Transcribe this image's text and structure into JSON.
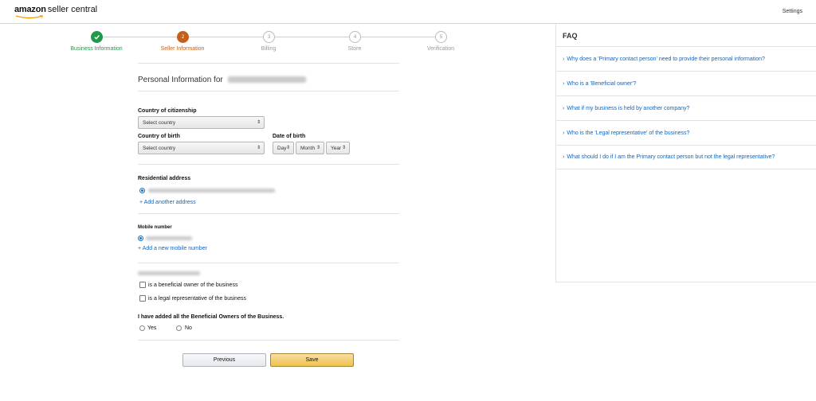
{
  "header": {
    "logo_main": "amazon",
    "logo_sub": "seller central",
    "settings_label": "Settings"
  },
  "steps": [
    {
      "label": "Business Information",
      "number": "1",
      "status": "done"
    },
    {
      "label": "Seller Information",
      "number": "2",
      "status": "current"
    },
    {
      "label": "Billing",
      "number": "3",
      "status": "todo"
    },
    {
      "label": "Store",
      "number": "4",
      "status": "todo"
    },
    {
      "label": "Verification",
      "number": "5",
      "status": "todo"
    }
  ],
  "form": {
    "title": "Personal Information for",
    "citizenship_label": "Country of citizenship",
    "citizenship_value": "Select country",
    "birth_country_label": "Country of birth",
    "birth_country_value": "Select country",
    "dob_label": "Date of birth",
    "dob_day": "Day",
    "dob_month": "Month",
    "dob_year": "Year",
    "address_label": "Residential address",
    "add_address_link": "+ Add another address",
    "mobile_label": "Mobile number",
    "add_mobile_link": "+ Add a new mobile number",
    "beneficial_owner_label": "is a beneficial owner of the business",
    "legal_rep_label": "is a legal representative of the business",
    "all_owners_question": "I have added all the Beneficial Owners of the Business.",
    "yes_label": "Yes",
    "no_label": "No",
    "previous_button": "Previous",
    "save_button": "Save"
  },
  "faq": {
    "title": "FAQ",
    "items": [
      "Why does a 'Primary contact person' need to provide their personal information?",
      "Who is a 'Beneficial owner'?",
      "What if my business is held by another company?",
      "Who is the 'Legal representative' of the business?",
      "What should I do if I am the Primary contact person but not the legal representative?"
    ]
  },
  "colors": {
    "done": "#1f9a4a",
    "current": "#c5601b",
    "link": "#0f66c0",
    "save_button": "#f0c14b"
  }
}
